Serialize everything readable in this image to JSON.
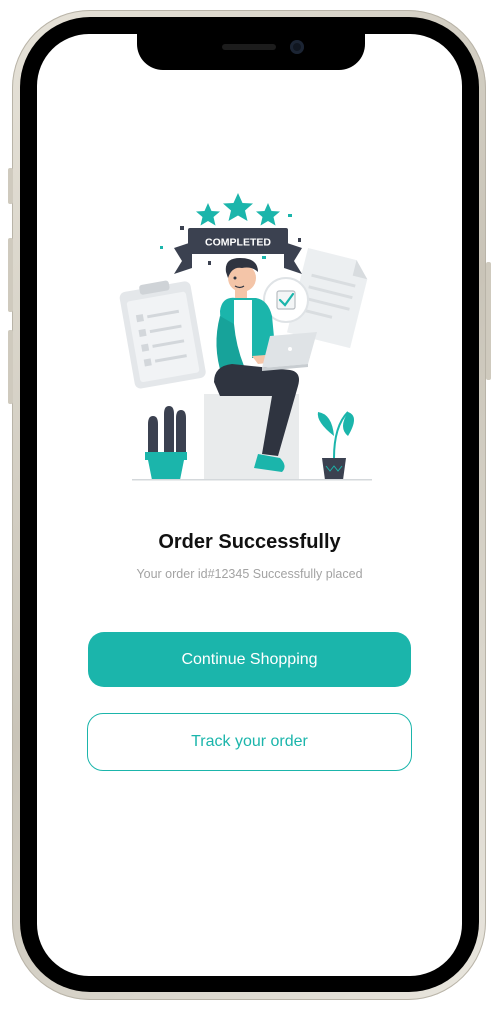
{
  "badge": {
    "text": "COMPLETED"
  },
  "order": {
    "title": "Order Successfully",
    "subtitle": "Your order id#12345 Successfully placed"
  },
  "actions": {
    "continue_label": "Continue Shopping",
    "track_label": "Track your order"
  },
  "colors": {
    "accent": "#1bb5ab",
    "dark": "#3b4150",
    "title": "#111111",
    "muted": "#a3a3a3"
  }
}
